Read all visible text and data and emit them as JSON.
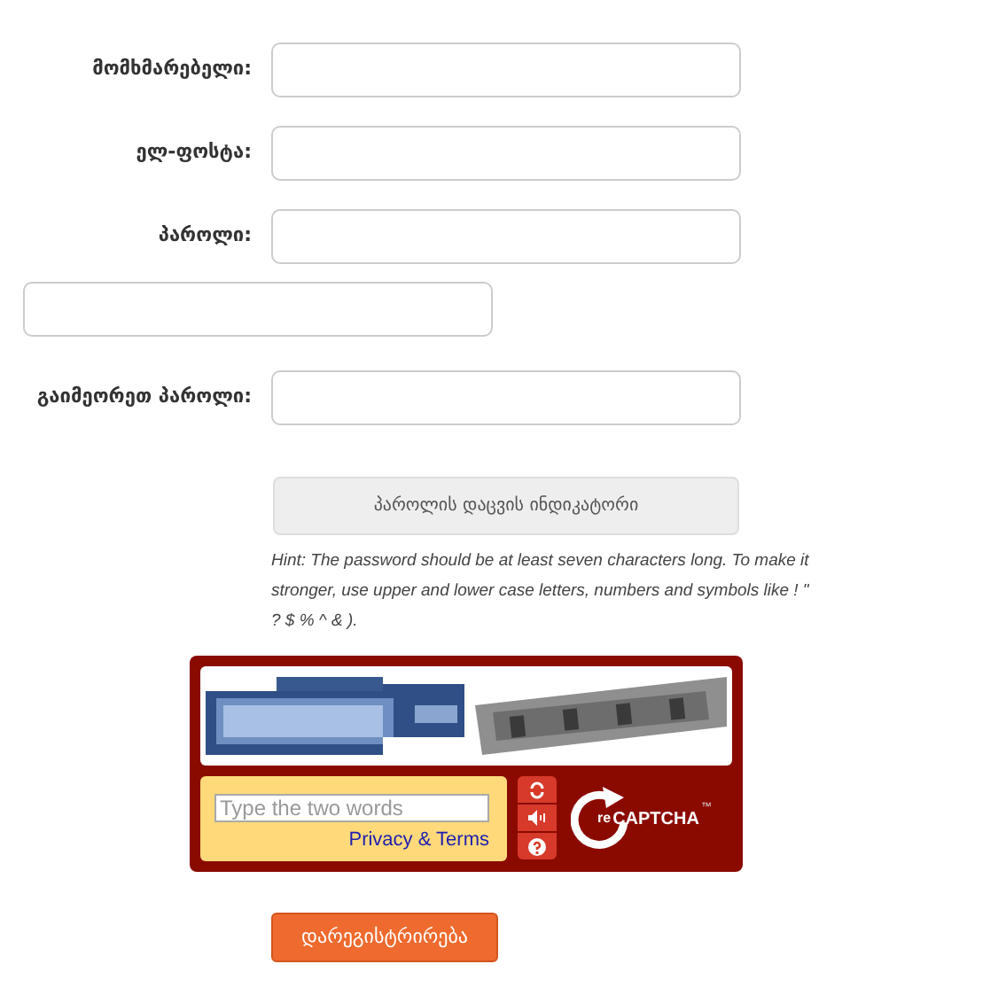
{
  "fields": [
    {
      "kind": "labeled",
      "label": "მომხმარებელი:"
    },
    {
      "kind": "labeled",
      "label": "ელ-ფოსტა:"
    },
    {
      "kind": "labeled",
      "label": "პაროლი:"
    },
    {
      "kind": "bare"
    },
    {
      "kind": "labeled",
      "label": "გაიმეორეთ პაროლი:"
    }
  ],
  "strength_indicator": "პაროლის დაცვის ინდიკატორი",
  "hint": "Hint: The password should be at least seven characters long. To make it stronger, use upper and lower case letters, numbers and symbols like ! \" ? $ % ^ & ).",
  "captcha": {
    "placeholder": "Type the two words",
    "link": "Privacy & Terms",
    "logo_prefix": "re",
    "logo_text": "CAPTCHA",
    "logo_mark": "™"
  },
  "submit": "დარეგისტრირება"
}
